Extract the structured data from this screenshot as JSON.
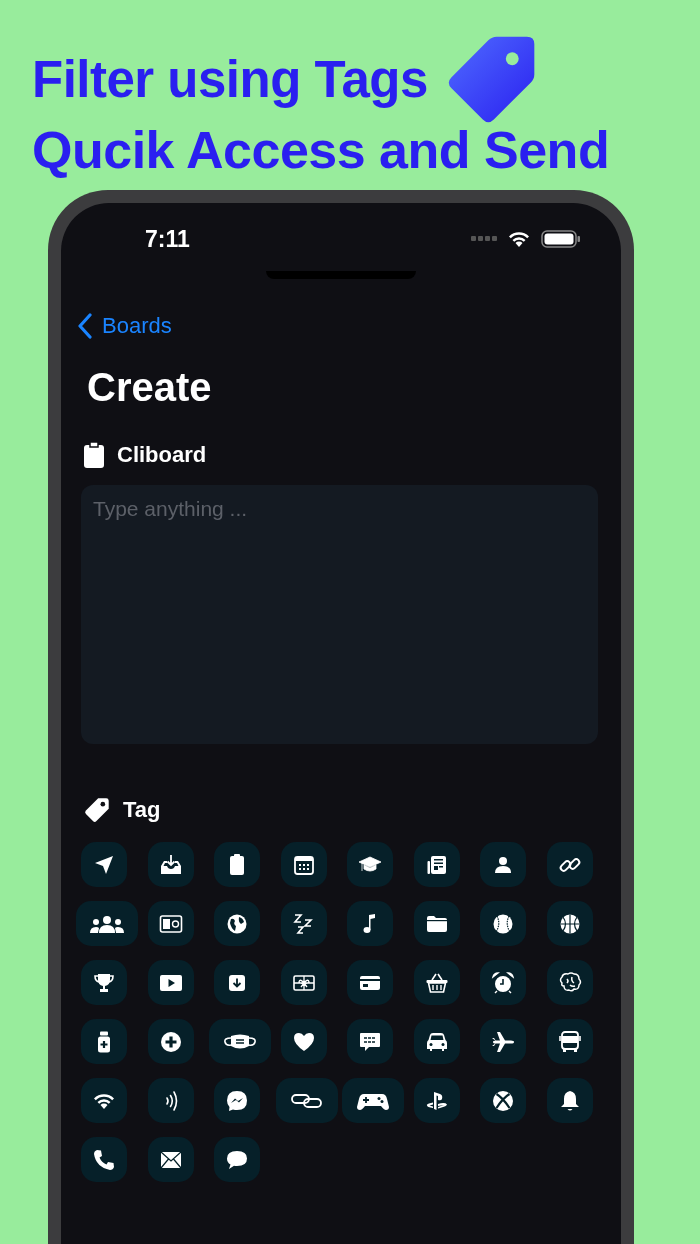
{
  "headline": [
    "Filter using Tags",
    "Qucik Access and Send"
  ],
  "status_bar": {
    "time": "7:11"
  },
  "nav": {
    "back": "Boards"
  },
  "title": "Create",
  "clipboard_section": {
    "label": "Cliboard",
    "field": {
      "placeholder": "Type anything ..."
    }
  },
  "tag_section": {
    "label": "Tag"
  },
  "tags": [
    {
      "kind": "send"
    },
    {
      "kind": "inbox"
    },
    {
      "kind": "clipboard"
    },
    {
      "kind": "calendar"
    },
    {
      "kind": "cap"
    },
    {
      "kind": "newspaper"
    },
    {
      "kind": "person"
    },
    {
      "kind": "link"
    },
    {
      "kind": "people"
    },
    {
      "kind": "contact"
    },
    {
      "kind": "globe"
    },
    {
      "kind": "sleep"
    },
    {
      "kind": "music"
    },
    {
      "kind": "folder"
    },
    {
      "kind": "baseball"
    },
    {
      "kind": "basketball"
    },
    {
      "kind": "trophy"
    },
    {
      "kind": "play"
    },
    {
      "kind": "download"
    },
    {
      "kind": "gift"
    },
    {
      "kind": "card"
    },
    {
      "kind": "basket"
    },
    {
      "kind": "alarm"
    },
    {
      "kind": "brain"
    },
    {
      "kind": "bottle"
    },
    {
      "kind": "plus"
    },
    {
      "kind": "mask"
    },
    {
      "kind": "heart"
    },
    {
      "kind": "chat"
    },
    {
      "kind": "car"
    },
    {
      "kind": "plane"
    },
    {
      "kind": "bus"
    },
    {
      "kind": "wifi"
    },
    {
      "kind": "contactless"
    },
    {
      "kind": "bolt-bubble"
    },
    {
      "kind": "chain"
    },
    {
      "kind": "gamepad"
    },
    {
      "kind": "console"
    },
    {
      "kind": "x-ball"
    },
    {
      "kind": "bell"
    },
    {
      "kind": "phone"
    },
    {
      "kind": "envelope"
    },
    {
      "kind": "bubble"
    }
  ]
}
